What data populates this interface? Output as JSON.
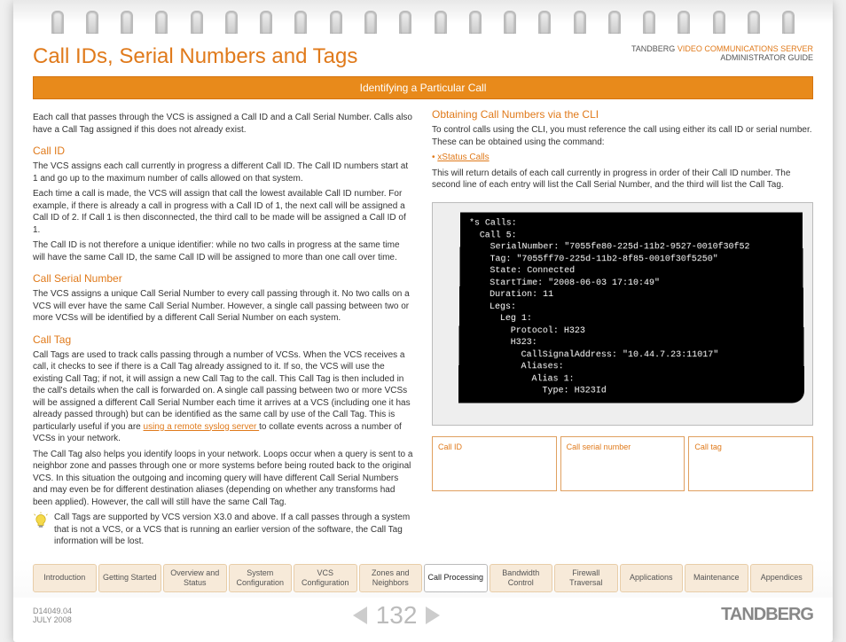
{
  "header": {
    "title": "Call IDs, Serial Numbers and Tags",
    "brand": "TANDBERG",
    "product": "VIDEO COMMUNICATIONS SERVER",
    "doc_type": "ADMINISTRATOR GUIDE"
  },
  "ribbon": "Identifying a Particular Call",
  "left_column": {
    "intro": "Each call that passes through the VCS is assigned a Call ID and a Call Serial Number. Calls also have a Call Tag assigned if this does not already exist.",
    "call_id": {
      "heading": "Call ID",
      "p1": "The VCS assigns each call currently in progress a different Call ID.  The Call ID numbers start at 1 and go up to the maximum number of calls allowed on that system.",
      "p2": "Each time a call is made, the VCS will assign that call the lowest available Call ID number.  For example, if there is already a call in progress with a Call ID of 1, the next call will be assigned a Call ID of 2.  If Call 1 is then disconnected, the third call to be made will be assigned a Call ID of 1.",
      "p3": "The Call ID is not therefore a unique identifier: while no two calls in progress at the same time will have the same Call ID, the same Call ID will be assigned to more than one call over time."
    },
    "serial": {
      "heading": "Call Serial Number",
      "p1": "The VCS assigns a unique Call Serial Number to every call passing through it.  No two calls on a VCS will ever have the same Call Serial Number.  However, a single call passing between two or more VCSs will be identified by a different Call Serial Number on each system."
    },
    "tag": {
      "heading": "Call Tag",
      "p1_a": "Call Tags are used to track calls passing through a number of VCSs.  When the VCS receives a call, it checks to see if there is a Call Tag already assigned to it.  If so, the VCS will use the existing Call Tag; if not, it will assign a new Call Tag to the call.  This Call Tag is then included in the call's details when the call is forwarded on. A single call passing between two or more VCSs will be assigned a different Call Serial Number each time it arrives at a VCS (including one it has already passed through) but can be identified as the same call by use of the Call Tag.  This is particularly useful if you are ",
      "link": "using a remote syslog server ",
      "p1_b": "to collate events across a number of VCSs in your network.",
      "p2": "The Call Tag also helps you identify loops in your network.  Loops occur when a query is sent to a neighbor zone and passes through one or more systems before being routed back to the original VCS.  In this situation the outgoing and incoming query will have different Call Serial Numbers and may even be for different destination aliases (depending on whether any transforms had been applied).  However, the call will still have the same Call Tag.",
      "tip": "Call Tags are supported by VCS version X3.0 and above.  If a call passes through a system that is not a VCS, or a VCS that is running an earlier version of the software, the Call Tag information will be lost."
    }
  },
  "right_column": {
    "heading": "Obtaining Call Numbers via the CLI",
    "p1": "To control calls using the CLI, you must reference the call using either its call ID or serial number. These can be obtained using the command:",
    "command": "xStatus Calls",
    "p2": "This will return details of each call currently in progress in order of their Call ID number.   The second line of each entry will list the Call Serial Number, and the third will list the Call Tag.",
    "terminal": "*s Calls:\n  Call 5:\n    SerialNumber: \"7055fe80-225d-11b2-9527-0010f30f52\n    Tag: \"7055ff70-225d-11b2-8f85-0010f30f5250\"\n    State: Connected\n    StartTime: \"2008-06-03 17:10:49\"\n    Duration: 11\n    Legs:\n      Leg 1:\n        Protocol: H323\n        H323:\n          CallSignalAddress: \"10.44.7.23:11017\"\n          Aliases:\n            Alias 1:\n              Type: H323Id",
    "callouts": [
      "Call ID",
      "Call serial number",
      "Call tag"
    ]
  },
  "nav": [
    {
      "label": "Introduction",
      "active": false
    },
    {
      "label": "Getting Started",
      "active": false
    },
    {
      "label": "Overview and Status",
      "active": false
    },
    {
      "label": "System Configuration",
      "active": false
    },
    {
      "label": "VCS Configuration",
      "active": false
    },
    {
      "label": "Zones and Neighbors",
      "active": false
    },
    {
      "label": "Call Processing",
      "active": true
    },
    {
      "label": "Bandwidth Control",
      "active": false
    },
    {
      "label": "Firewall Traversal",
      "active": false
    },
    {
      "label": "Applications",
      "active": false
    },
    {
      "label": "Maintenance",
      "active": false
    },
    {
      "label": "Appendices",
      "active": false
    }
  ],
  "footer": {
    "doc_number": "D14049.04",
    "doc_date": "JULY 2008",
    "page_number": "132",
    "brand": "TANDBERG"
  }
}
